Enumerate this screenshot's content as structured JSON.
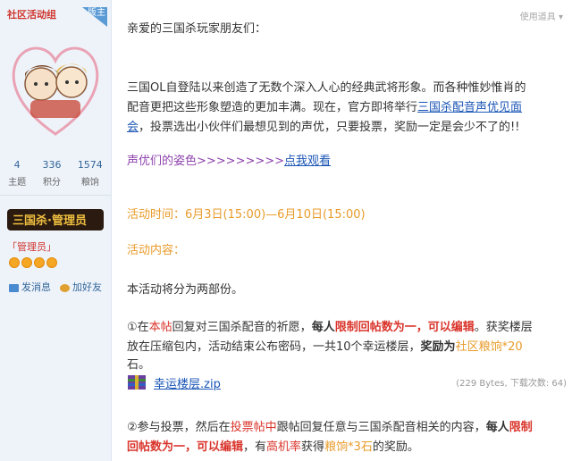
{
  "user": {
    "name": "社区活动组",
    "badge": "版主",
    "stats": [
      {
        "value": "4",
        "label": "主题"
      },
      {
        "value": "336",
        "label": "积分"
      },
      {
        "value": "1574",
        "label": "粮饷"
      }
    ],
    "rank_image_text": "三国杀·管理员",
    "group": "「管理员」",
    "star_count": 4,
    "actions": {
      "message": "发消息",
      "friend": "加好友"
    }
  },
  "toolbar": {
    "tools": "使用道具 ▾"
  },
  "post": {
    "greeting": "亲爱的三国杀玩家朋友们：",
    "p1_line1": "三国OL自登陆以来创造了无数个深入人心的经典武将形象。而各种惟妙惟肖的",
    "p1_line2a": "配音更把这些形象塑造的更加丰满。现在，官方即将举行",
    "p1_link1": "三国杀配音声优见面",
    "p1_link2": "会",
    "p1_line3": "，投票选出小伙伴们最想见到的声优，只要投票，奖励一定是会少不了的!!",
    "voice_text": "声优们的姿色>>>>>>>>>",
    "voice_link": "点我观看",
    "time_label": "活动时间：",
    "time_value": "6月3日(15:00)—6月10日(15:00)",
    "content_label": "活动内容：",
    "intro": "本活动将分为两部份。",
    "s1_a": "①在",
    "s1_b": "本帖",
    "s1_c": "回复对三国杀配音的祈愿，",
    "s1_d": "每人",
    "s1_e": "限制回帖数为一，可以编辑",
    "s1_f": "。获奖楼层",
    "s1_line2": "放在压缩包内，活动结束公布密码，一共10个幸运楼层，",
    "s1_g": "奖励为",
    "s1_h": "社区粮饷*20",
    "s1_line3": "石。",
    "attachment": "幸运楼层.zip",
    "attachment_info": "(229 Bytes, 下载次数: 64)",
    "s2_a": "②参与投票，然后在",
    "s2_b": "投票帖中",
    "s2_c": "跟帖回复任意与三国杀配音相关的内容，",
    "s2_d": "每人",
    "s2_e": "限制",
    "s2_f": "回帖数为一，可以编辑",
    "s2_g": "，有",
    "s2_h": "高机率",
    "s2_i": "获得",
    "s2_j": "粮饷*3石",
    "s2_k": "的奖励。"
  }
}
